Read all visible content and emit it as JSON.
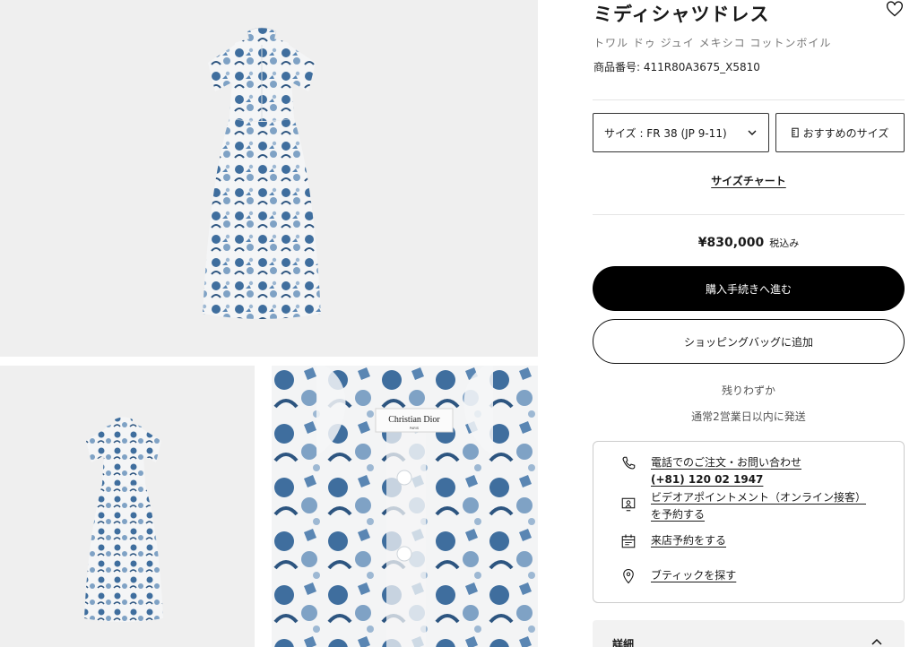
{
  "product": {
    "title": "ミディシャツドレス",
    "subtitle": "トワル ドゥ ジュイ メキシコ コットンボイル",
    "reference": "商品番号: 411R80A3675_X5810"
  },
  "size": {
    "selected": "サイズ : FR 38 (JP 9-11)",
    "recommend_label": "おすすめのサイズ",
    "chart_link": "サイズチャート"
  },
  "price": {
    "amount": "¥830,000",
    "tax_note": "税込み"
  },
  "actions": {
    "buy_label": "購入手続きへ進む",
    "bag_label": "ショッピングバッグに追加"
  },
  "availability": {
    "stock": "残りわずか",
    "shipping": "通常2営業日以内に発送"
  },
  "contact": {
    "phone_label": "電話でのご注文・お問い合わせ",
    "phone_number": "(+81) 120 02 1947",
    "video_line1": "ビデオアポイントメント（オンライン接客）",
    "video_line2": "を予約する",
    "store_reserve": "来店予約をする",
    "boutique": "ブティックを探す"
  },
  "details": {
    "label": "詳細"
  },
  "images": {
    "label_brand": "Christian Dior",
    "label_city": "PARIS"
  },
  "colors": {
    "accent": "#000000",
    "print_blue": "#3f6e9e",
    "panel_bg": "#efefef"
  },
  "icons": [
    "heart-icon",
    "chevron-down-icon",
    "ruler-icon",
    "phone-icon",
    "video-call-icon",
    "calendar-icon",
    "location-pin-icon",
    "chevron-up-icon"
  ]
}
